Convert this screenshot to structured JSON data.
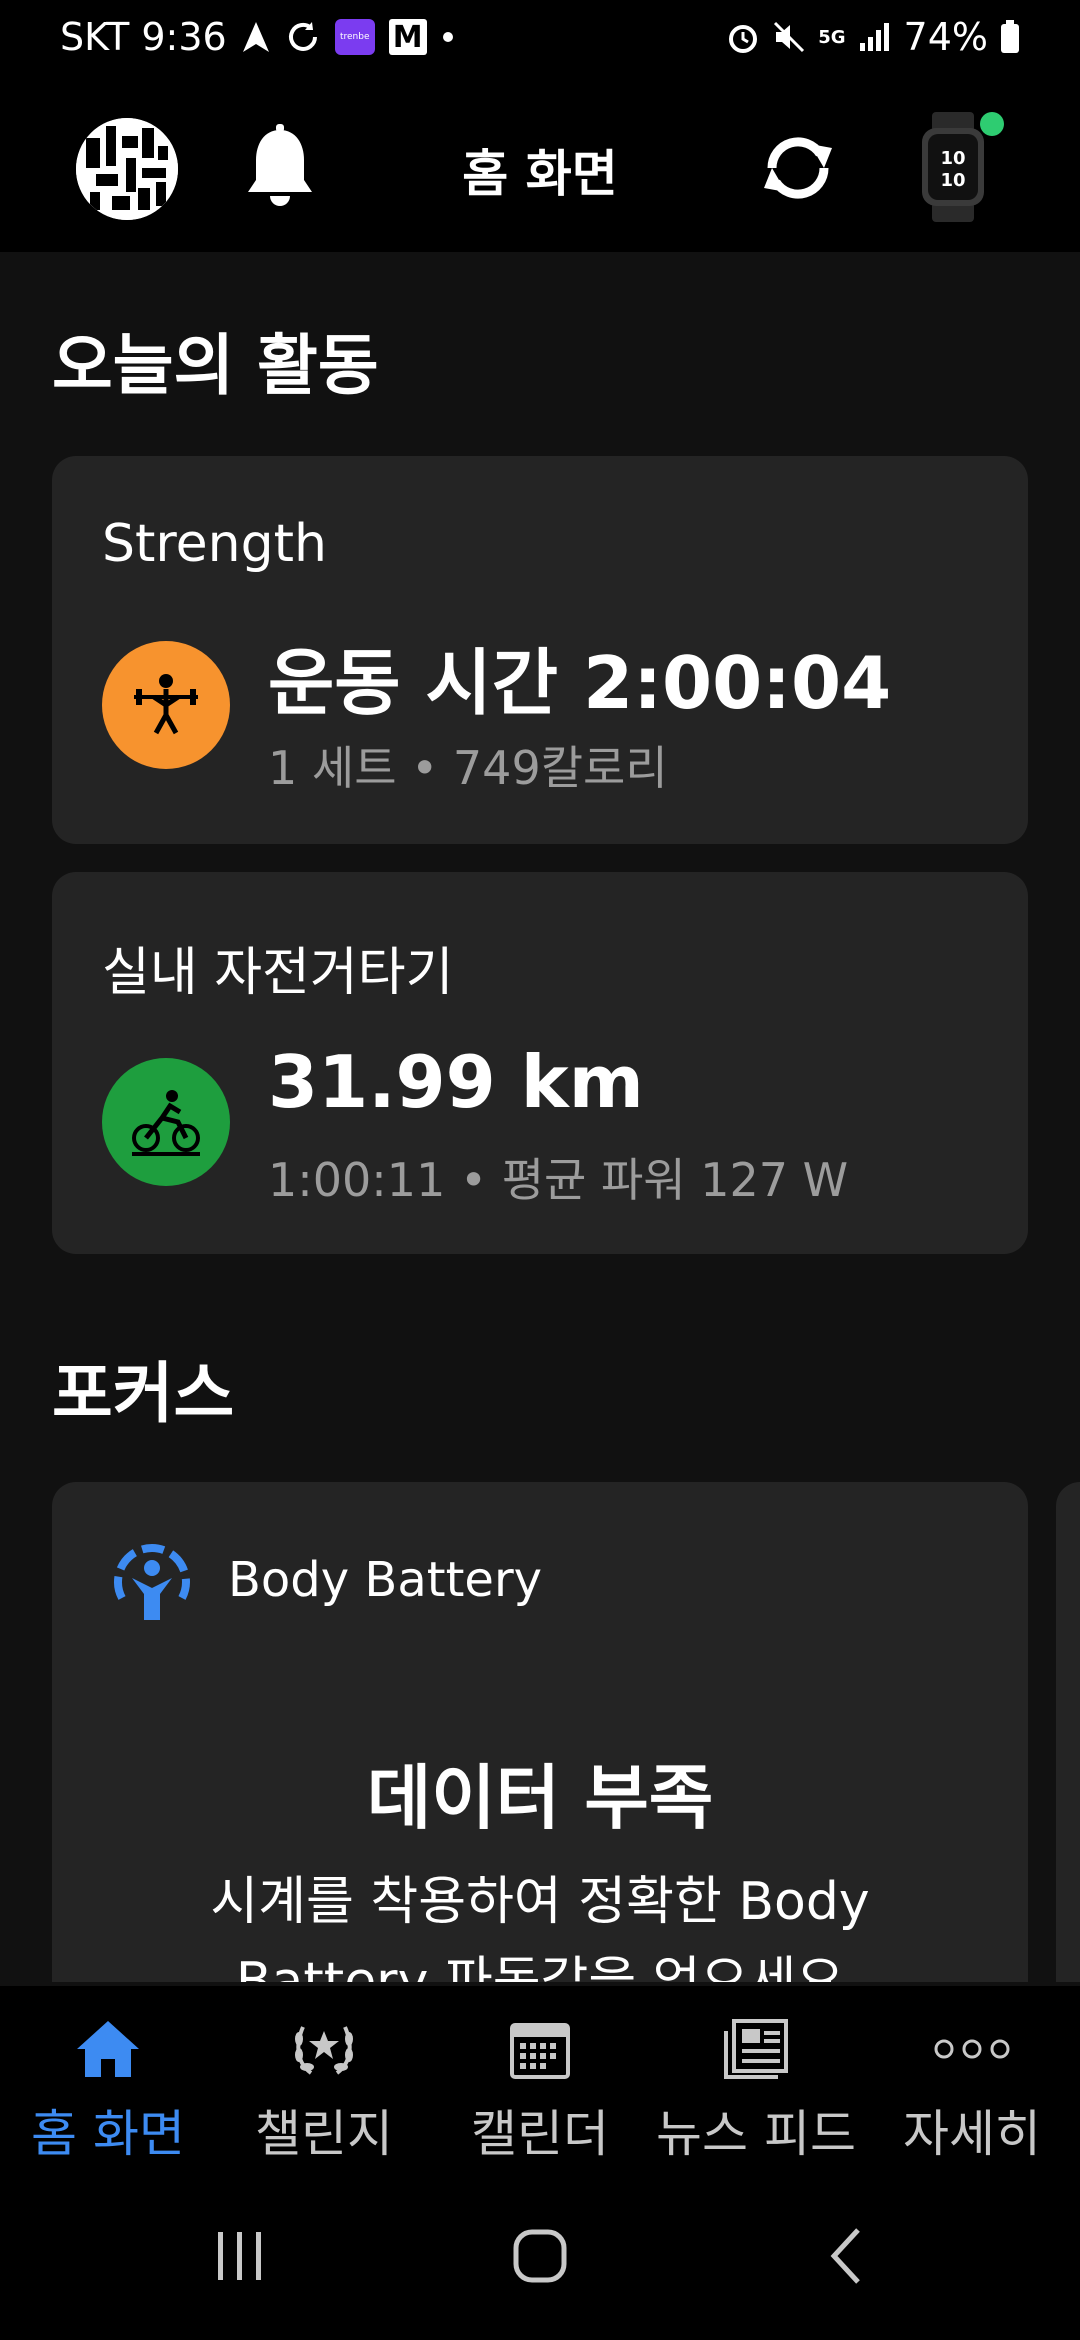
{
  "status_bar": {
    "carrier_time": "SKT 9:36",
    "battery": "74%",
    "network": "5G"
  },
  "header": {
    "title": "홈 화면"
  },
  "today": {
    "section_title": "오늘의 활동",
    "activities": [
      {
        "name": "Strength",
        "main": "운동 시간 2:00:04",
        "sub": "1 세트 • 749칼로리",
        "icon": "weightlifting-icon",
        "color": "#f7932e"
      },
      {
        "name": "실내 자전거타기",
        "main": "31.99 km",
        "sub": "1:00:11 • 평균 파워 127 W",
        "icon": "cycling-icon",
        "color": "#1e9e3e"
      }
    ]
  },
  "focus": {
    "section_title": "포커스",
    "card_label": "Body Battery",
    "title": "데이터 부족",
    "desc_line1": "시계를 착용하여 정확한 Body",
    "desc_line2": "Battery 파동값을 얻으세요"
  },
  "bottom_nav": {
    "items": [
      {
        "label": "홈 화면",
        "icon": "home-icon",
        "active": true
      },
      {
        "label": "챌린지",
        "icon": "laurel-icon",
        "active": false
      },
      {
        "label": "캘린더",
        "icon": "calendar-icon",
        "active": false
      },
      {
        "label": "뉴스 피드",
        "icon": "newsfeed-icon",
        "active": false
      },
      {
        "label": "자세히",
        "icon": "more-icon",
        "active": false
      }
    ]
  },
  "colors": {
    "accent": "#3d8bf2",
    "background": "#111111",
    "card": "#242424"
  }
}
